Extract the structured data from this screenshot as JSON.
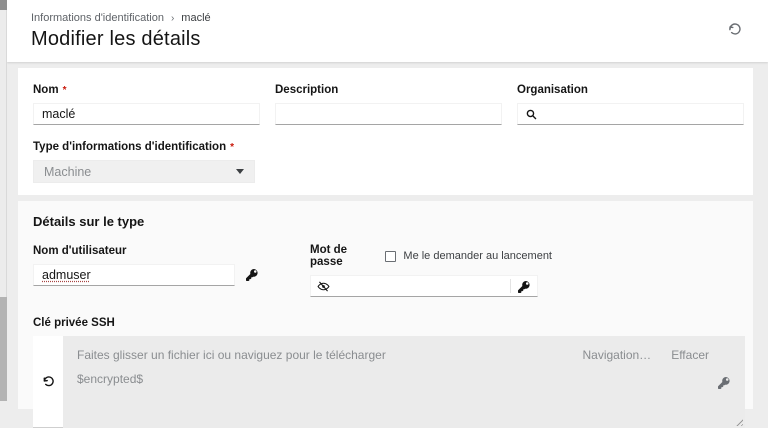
{
  "breadcrumb": {
    "parent": "Informations d'identification",
    "separator": "›",
    "current": "maclé"
  },
  "header": {
    "title": "Modifier les détails"
  },
  "form": {
    "name": {
      "label": "Nom",
      "required": "*",
      "value": "maclé",
      "placeholder": ""
    },
    "description": {
      "label": "Description",
      "value": "",
      "placeholder": ""
    },
    "organization": {
      "label": "Organisation",
      "value": "",
      "placeholder": ""
    },
    "credential_type": {
      "label": "Type d'informations d'identification",
      "required": "*",
      "selected": "Machine"
    },
    "type_details": {
      "heading": "Détails sur le type",
      "username": {
        "label": "Nom d'utilisateur",
        "value": "admuser"
      },
      "password": {
        "label": "Mot de passe",
        "value": "",
        "prompt_on_launch_label": "Me le demander au lancement",
        "prompt_on_launch_checked": false
      },
      "ssh_key": {
        "label": "Clé privée SSH",
        "dropzone_hint": "Faites glisser un fichier ici ou naviguez pour le télécharger",
        "value": "$encrypted$",
        "browse_button": "Navigation…",
        "clear_button": "Effacer"
      }
    }
  },
  "icons": {
    "history": "history-icon",
    "search": "search-icon",
    "caret": "chevron-down-icon",
    "key": "key-icon",
    "eye_slash": "eye-slash-icon",
    "undo": "undo-icon"
  },
  "colors": {
    "page_bg": "#ededed",
    "card_bg": "#ffffff",
    "section_bg": "#fafafa",
    "dropzone_bg": "#ebebeb",
    "muted_text": "#8a8d90",
    "required_asterisk": "#c9190b"
  }
}
